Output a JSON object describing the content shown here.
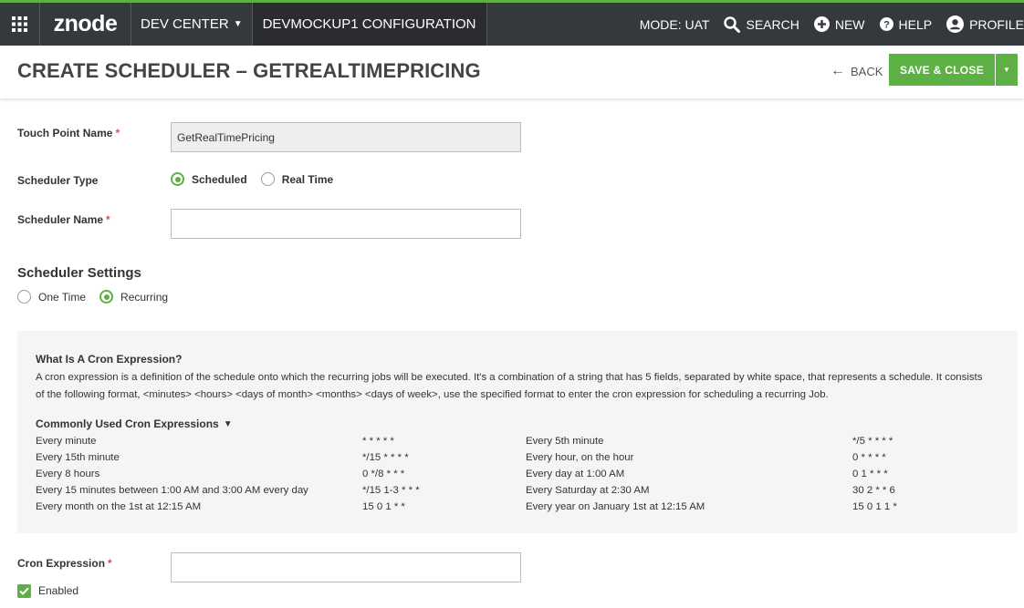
{
  "nav": {
    "logo": "znode",
    "dev_center": "DEV CENTER",
    "config": "DEVMOCKUP1 CONFIGURATION",
    "mode": "MODE: UAT",
    "search": "SEARCH",
    "new": "NEW",
    "help": "HELP",
    "profile": "PROFILE"
  },
  "header": {
    "title": "CREATE SCHEDULER  –  GETREALTIMEPRICING",
    "back": "BACK",
    "save_close": "SAVE & CLOSE"
  },
  "form": {
    "touch_point_label": "Touch Point Name",
    "touch_point_value": "GetRealTimePricing",
    "scheduler_type_label": "Scheduler Type",
    "type_options": [
      "Scheduled",
      "Real Time"
    ],
    "scheduler_name_label": "Scheduler Name",
    "scheduler_name_value": "",
    "settings_title": "Scheduler Settings",
    "settings_options": [
      "One Time",
      "Recurring"
    ],
    "cron_label": "Cron Expression",
    "cron_value": "",
    "enabled_label": "Enabled",
    "required_mark": "*"
  },
  "cron_info": {
    "title": "What Is A Cron Expression?",
    "description": "A cron expression is a definition of the schedule onto which the recurring jobs will be executed. It's a combination of a string that has 5 fields, separated by white space, that represents a schedule. It consists of the following format, <minutes> <hours> <days of month> <months> <days of week>, use the specified format to enter the cron expression for scheduling a recurring Job.",
    "common_title": "Commonly Used Cron Expressions",
    "rows": [
      {
        "d1": "Every minute",
        "e1": "* * * * *",
        "d2": "Every 5th minute",
        "e2": "*/5 * * * *"
      },
      {
        "d1": "Every 15th minute",
        "e1": "*/15 * * * *",
        "d2": "Every hour, on the hour",
        "e2": "0 * * * *"
      },
      {
        "d1": "Every 8 hours",
        "e1": "0 */8 * * *",
        "d2": "Every day at 1:00 AM",
        "e2": "0 1 * * *"
      },
      {
        "d1": "Every 15 minutes between 1:00 AM and 3:00 AM every day",
        "e1": "*/15 1-3 * * *",
        "d2": "Every Saturday at 2:30 AM",
        "e2": "30 2 * * 6"
      },
      {
        "d1": "Every month on the 1st at 12:15 AM",
        "e1": "15 0 1 * *",
        "d2": "Every year on January 1st at 12:15 AM",
        "e2": "15 0 1 1 *"
      }
    ]
  },
  "colors": {
    "accent": "#5db043",
    "nav_bg": "#35383d",
    "required": "#d9534f"
  }
}
